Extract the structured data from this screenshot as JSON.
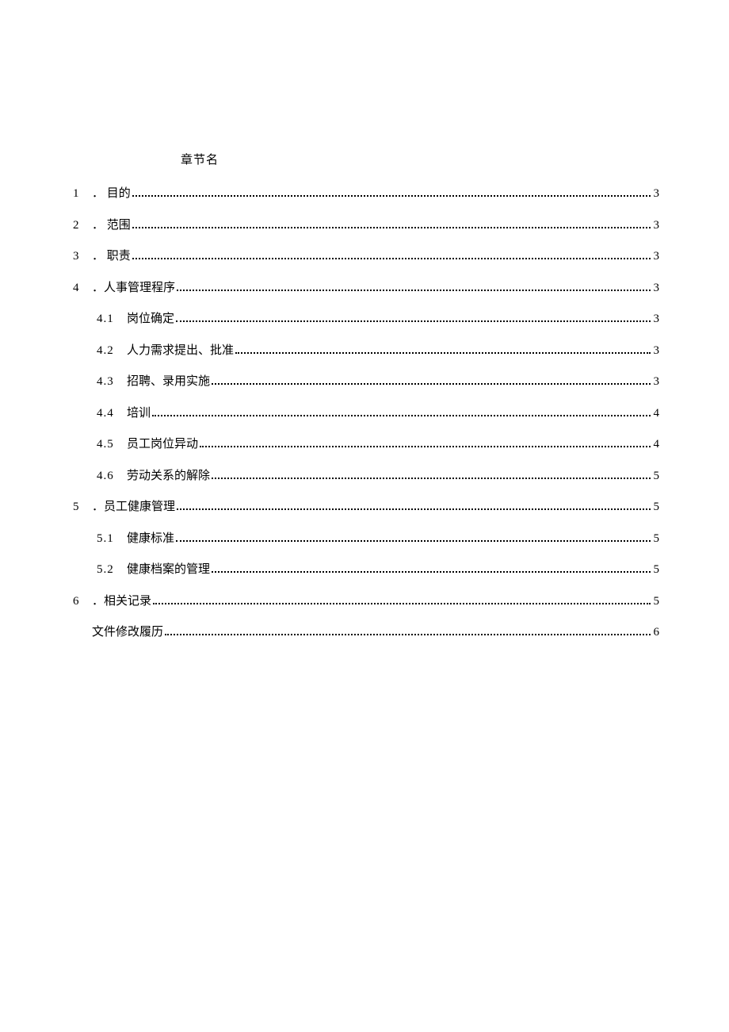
{
  "heading": "章节名",
  "toc": [
    {
      "num": "1",
      "title": "．  目的",
      "page": "3",
      "level": 1
    },
    {
      "num": "2",
      "title": "．  范围",
      "page": "3",
      "level": 1
    },
    {
      "num": "3",
      "title": "．  职责",
      "page": "3",
      "level": 1
    },
    {
      "num": "4",
      "title": "．人事管理程序",
      "page": "3",
      "level": 1
    },
    {
      "num": "4.1",
      "title": "岗位确定",
      "page": "3",
      "level": 2
    },
    {
      "num": "4.2",
      "title": "人力需求提出、批准",
      "page": "3",
      "level": 2
    },
    {
      "num": "4.3",
      "title": "招聘、录用实施",
      "page": "3",
      "level": 2
    },
    {
      "num": "4.4",
      "title": "培训",
      "page": "4",
      "level": 2
    },
    {
      "num": "4.5",
      "title": "员工岗位异动",
      "page": "4",
      "level": 2
    },
    {
      "num": "4.6",
      "title": "劳动关系的解除",
      "page": "5",
      "level": 2
    },
    {
      "num": "5",
      "title": "．员工健康管理",
      "page": "5",
      "level": 1
    },
    {
      "num": "5.1",
      "title": "健康标准",
      "page": "5",
      "level": 2
    },
    {
      "num": "5.2",
      "title": "健康档案的管理",
      "page": "5",
      "level": 2
    },
    {
      "num": "6",
      "title": "．相关记录",
      "page": "5",
      "level": 1
    },
    {
      "num": "",
      "title": "文件修改履历",
      "page": "6",
      "level": 1
    }
  ]
}
